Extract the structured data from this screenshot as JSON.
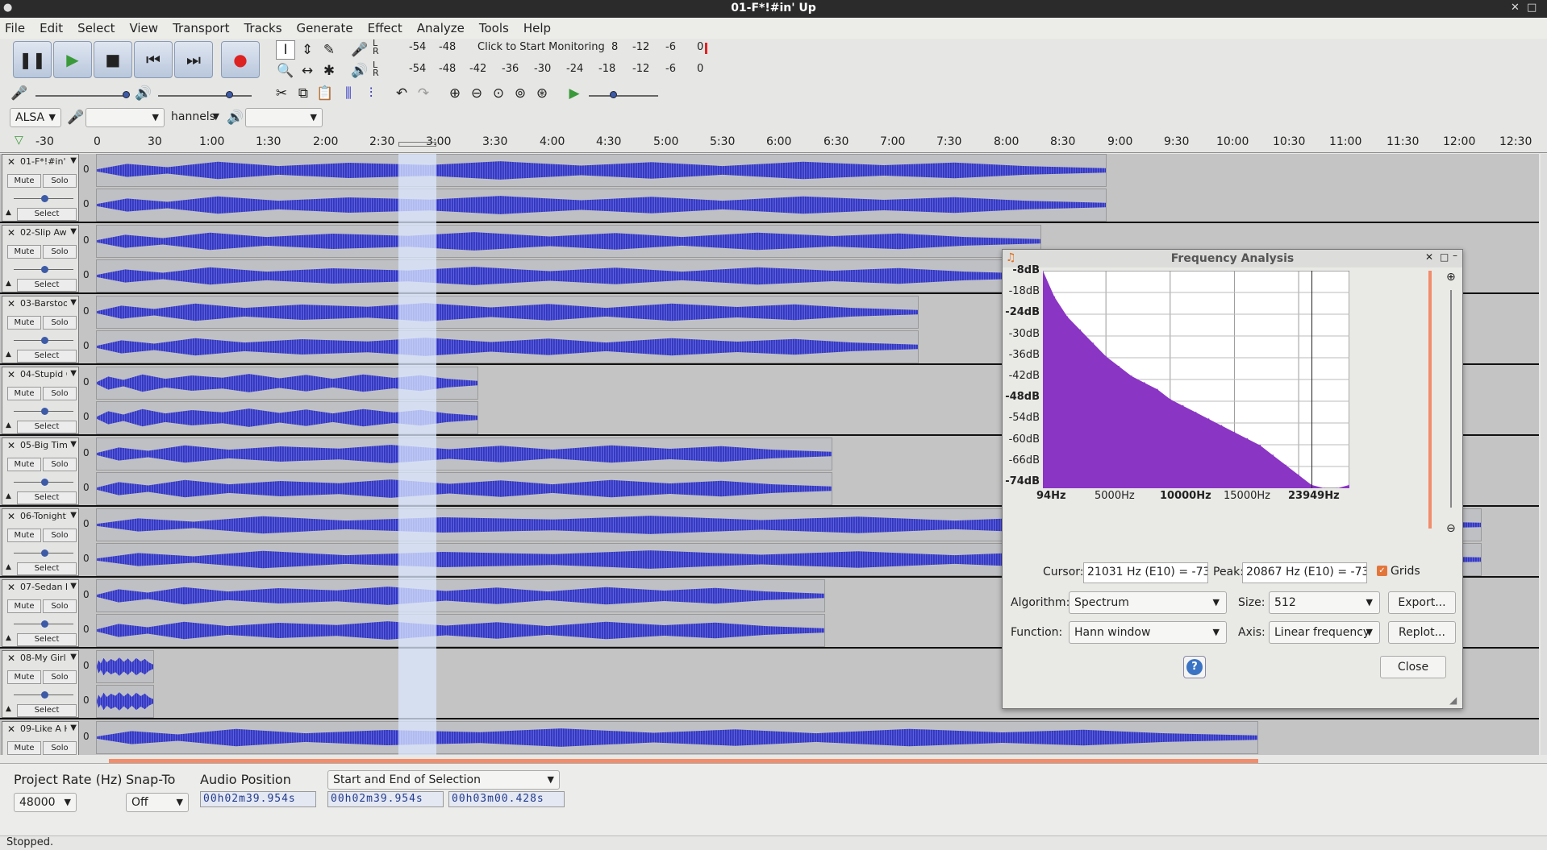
{
  "window": {
    "title": "01-F*!#in' Up"
  },
  "menu": [
    "File",
    "Edit",
    "Select",
    "View",
    "Transport",
    "Tracks",
    "Generate",
    "Effect",
    "Analyze",
    "Tools",
    "Help"
  ],
  "meters": {
    "record_labels": [
      "-54",
      "-48",
      "Click to Start Monitoring",
      "8",
      "-12",
      "-6",
      "0"
    ],
    "play_labels": [
      "-54",
      "-48",
      "-42",
      "-36",
      "-30",
      "-24",
      "-18",
      "-12",
      "-6",
      "0"
    ],
    "lr": [
      "L",
      "R"
    ]
  },
  "device": {
    "host": "ALSA",
    "channels_suffix": "hannels"
  },
  "ruler": [
    "-30",
    "0",
    "30",
    "1:00",
    "1:30",
    "2:00",
    "2:30",
    "3:00",
    "3:30",
    "4:00",
    "4:30",
    "5:00",
    "5:30",
    "6:00",
    "6:30",
    "7:00",
    "7:30",
    "8:00",
    "8:30",
    "9:00",
    "9:30",
    "10:00",
    "10:30",
    "11:00",
    "11:30",
    "12:00",
    "12:30"
  ],
  "track_controls": {
    "mute": "Mute",
    "solo": "Solo",
    "select": "Select",
    "zero": "0"
  },
  "tracks": [
    {
      "name": "01-F*!#in' U",
      "length": 0.7
    },
    {
      "name": "02-Slip Away",
      "length": 0.655
    },
    {
      "name": "03-Barstool",
      "length": 0.57
    },
    {
      "name": "04-Stupid Gir",
      "length": 0.265
    },
    {
      "name": "05-Big Time",
      "length": 0.51
    },
    {
      "name": "06-Tonight's",
      "length": 0.96
    },
    {
      "name": "07-Sedan De",
      "length": 0.505
    },
    {
      "name": "08-My Girl",
      "length": 0.04
    },
    {
      "name": "09-Like A Hu",
      "length": 0.805
    }
  ],
  "bottom": {
    "project_rate_label": "Project Rate (Hz)",
    "project_rate": "48000",
    "snap_label": "Snap-To",
    "snap_value": "Off",
    "audio_position_label": "Audio Position",
    "selection_mode": "Start and End of Selection",
    "audio_position": "00h02m39.954s",
    "sel_start": "00h02m39.954s",
    "sel_end": "00h03m00.428s"
  },
  "status": "Stopped.",
  "freq_dialog": {
    "title": "Frequency Analysis",
    "db_ticks": [
      "-8dB",
      "-18dB",
      "-24dB",
      "-30dB",
      "-36dB",
      "-42dB",
      "-48dB",
      "-54dB",
      "-60dB",
      "-66dB",
      "-74dB"
    ],
    "freq_ticks": [
      "94Hz",
      "5000Hz",
      "10000Hz",
      "15000Hz",
      "23949Hz"
    ],
    "cursor_label": "Cursor:",
    "cursor_value": "21031 Hz (E10) = -73",
    "peak_label": "Peak:",
    "peak_value": "20867 Hz (E10) = -73.",
    "grids_label": "Grids",
    "grids_checked": true,
    "algorithm_label": "Algorithm:",
    "algorithm": "Spectrum",
    "size_label": "Size:",
    "size": "512",
    "function_label": "Function:",
    "function": "Hann window",
    "axis_label": "Axis:",
    "axis": "Linear frequency",
    "export": "Export...",
    "replot": "Replot...",
    "help": "?",
    "close": "Close",
    "spectrum_color": "#8a35c4"
  },
  "chart_data": {
    "type": "area",
    "xlabel": "",
    "ylabel": "",
    "x": [
      94,
      1000,
      2000,
      3000,
      4000,
      5000,
      6000,
      7000,
      8000,
      9000,
      10000,
      11000,
      12000,
      13000,
      14000,
      15000,
      16000,
      17000,
      18000,
      19000,
      20000,
      21000,
      22000,
      23000,
      23949
    ],
    "values": [
      -8,
      -16,
      -22,
      -26,
      -30,
      -34,
      -37,
      -40,
      -42,
      -44,
      -47,
      -49,
      -51,
      -53,
      -55,
      -57,
      -59,
      -61,
      -64,
      -67,
      -70,
      -73,
      -74,
      -74,
      -73
    ],
    "xlim": [
      94,
      23949
    ],
    "ylim": [
      -74,
      -8
    ],
    "grid": true
  }
}
